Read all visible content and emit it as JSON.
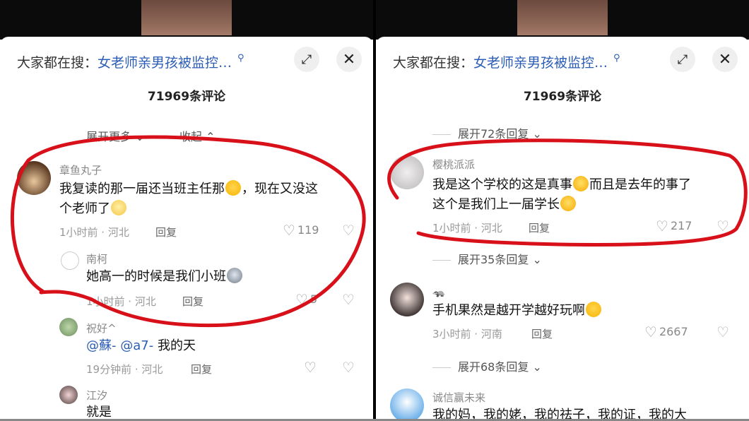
{
  "left": {
    "search_prefix": "大家都在搜：",
    "search_query": "女老师亲男孩被监控…",
    "comment_count": "71969条评论",
    "partial_expand": "展开更多",
    "partial_collapse": "收起",
    "comments": [
      {
        "user": "章鱼丸子",
        "text1": "我复读的那一届还当班主任那",
        "text1b": "，现在又没这",
        "text2": "个老师了",
        "meta": "1小时前 · 河北",
        "reply": "回复",
        "likes": "119"
      },
      {
        "user": "南柯",
        "text1": "她高一的时候是我们小班",
        "meta": "1小时前 · 河北",
        "reply": "回复",
        "likes": "5"
      },
      {
        "user": "祝好^",
        "mention1": "@蘇-",
        "mention2": "@a7-",
        "text1": " 我的天",
        "meta": "19分钟前 · 河北",
        "reply": "回复",
        "likes": ""
      },
      {
        "user": "江汐",
        "text1": "就是"
      }
    ]
  },
  "right": {
    "search_prefix": "大家都在搜：",
    "search_query": "女老师亲男孩被监控…",
    "comment_count": "71969条评论",
    "expand_top": "展开72条回复",
    "comments": [
      {
        "user": "樱桃派派",
        "text1": "我是这个学校的这是真事",
        "text1b": "而且是去年的事了",
        "text2": "这个是我们上一届学长",
        "meta": "1小时前 · 河北",
        "reply": "回复",
        "likes": "217"
      },
      {
        "expand": "展开35条回复"
      },
      {
        "user": "",
        "text1": "手机果然是越开学越好玩啊",
        "meta": "3小时前 · 河南",
        "reply": "回复",
        "likes": "2667"
      },
      {
        "expand": "展开68条回复"
      },
      {
        "user": "诚信赢未来",
        "text1": "我的妈，我的姥，我的祛子，我的证，我的大"
      }
    ]
  },
  "icons": {
    "search": "search-icon",
    "expand": "expand-icon",
    "close": "close-icon",
    "heart": "heart-icon",
    "dislike": "broken-heart-icon",
    "chevron": "chevron-down-icon"
  },
  "colors": {
    "link": "#2b5db5",
    "annotation": "#d8101a"
  }
}
